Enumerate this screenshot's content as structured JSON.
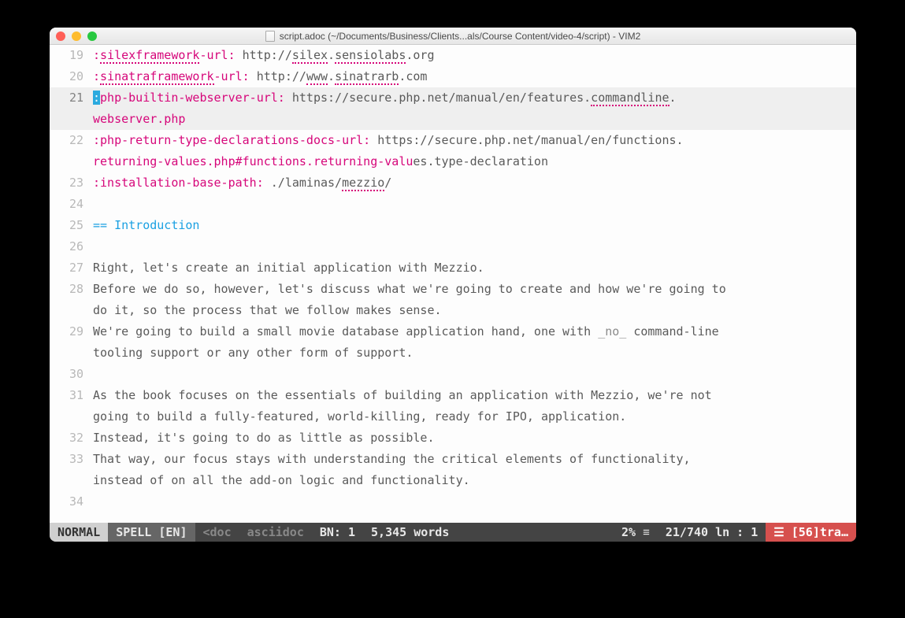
{
  "title": "script.adoc (~/Documents/Business/Clients...als/Course Content/video-4/script) - VIM2",
  "lines": [
    {
      "n": 19,
      "seg": [
        {
          "t": ":",
          "c": "attr"
        },
        {
          "t": "silexframework",
          "c": "attr spell"
        },
        {
          "t": "-url: ",
          "c": "attr"
        },
        {
          "t": "http://"
        },
        {
          "t": "silex",
          "c": "spell"
        },
        {
          "t": "."
        },
        {
          "t": "sensiolabs",
          "c": "spell"
        },
        {
          "t": ".org"
        }
      ]
    },
    {
      "n": 20,
      "seg": [
        {
          "t": ":",
          "c": "attr"
        },
        {
          "t": "sinatraframework",
          "c": "attr spell"
        },
        {
          "t": "-url: ",
          "c": "attr"
        },
        {
          "t": "http://"
        },
        {
          "t": "www",
          "c": "spell"
        },
        {
          "t": "."
        },
        {
          "t": "sinatrarb",
          "c": "spell"
        },
        {
          "t": ".com"
        }
      ]
    },
    {
      "n": 21,
      "hl": true,
      "seg": [
        {
          "t": ":",
          "c": "cursor"
        },
        {
          "t": "php-builtin-webserver-url: ",
          "c": "attr"
        },
        {
          "t": "https://secure.php.net/manual/en/features."
        },
        {
          "t": "commandline",
          "c": "spell"
        },
        {
          "t": "."
        }
      ],
      "cont": [
        {
          "t": "webserver.php",
          "c": "attr"
        }
      ]
    },
    {
      "n": 22,
      "seg": [
        {
          "t": ":php-return-type-declarations-docs-url: ",
          "c": "attr"
        },
        {
          "t": "https://secure.php.net/manual/en/functions."
        }
      ],
      "cont": [
        {
          "t": "returning-values.php#functions.returning-valu",
          "c": "attr"
        },
        {
          "t": "es.type-declaration"
        }
      ]
    },
    {
      "n": 23,
      "seg": [
        {
          "t": ":installation-base-path: ",
          "c": "attr"
        },
        {
          "t": "./laminas/"
        },
        {
          "t": "mezzio",
          "c": "spell"
        },
        {
          "t": "/"
        }
      ]
    },
    {
      "n": 24,
      "seg": [
        {
          "t": " "
        }
      ]
    },
    {
      "n": 25,
      "seg": [
        {
          "t": "== Introduction",
          "c": "hdr"
        }
      ]
    },
    {
      "n": 26,
      "seg": [
        {
          "t": " "
        }
      ]
    },
    {
      "n": 27,
      "seg": [
        {
          "t": "Right, let's create an initial application with Mezzio."
        }
      ]
    },
    {
      "n": 28,
      "seg": [
        {
          "t": "Before we do so, however, let's discuss what we're going to create and how we're going to "
        }
      ],
      "cont": [
        {
          "t": "do it, so the process that we follow makes sense."
        }
      ]
    },
    {
      "n": 29,
      "seg": [
        {
          "t": "We're going to build a small movie database application hand, one with "
        },
        {
          "t": "_no_",
          "c": "emph"
        },
        {
          "t": " command-line "
        }
      ],
      "cont": [
        {
          "t": "tooling support or any other form of support."
        }
      ]
    },
    {
      "n": 30,
      "seg": [
        {
          "t": " "
        }
      ]
    },
    {
      "n": 31,
      "seg": [
        {
          "t": "As the book focuses on the essentials of building an application with Mezzio, we're not "
        }
      ],
      "cont": [
        {
          "t": "going to build a fully-featured, world-killing, ready for IPO, application."
        }
      ]
    },
    {
      "n": 32,
      "seg": [
        {
          "t": "Instead, it's going to do as little as possible."
        }
      ]
    },
    {
      "n": 33,
      "seg": [
        {
          "t": "That way, our focus stays with understanding the critical elements of functionality, "
        }
      ],
      "cont": [
        {
          "t": "instead of on all the add-on logic and functionality."
        }
      ]
    },
    {
      "n": 34,
      "seg": [
        {
          "t": " "
        }
      ]
    }
  ],
  "status": {
    "mode": "NORMAL",
    "spell": "SPELL [EN]",
    "branch": "<doc",
    "ft": "asciidoc",
    "buf": "BN: 1",
    "words": "5,345 words",
    "pct": "2%",
    "pos": "21/740 ln :  1",
    "trail": "[56]tra…"
  }
}
